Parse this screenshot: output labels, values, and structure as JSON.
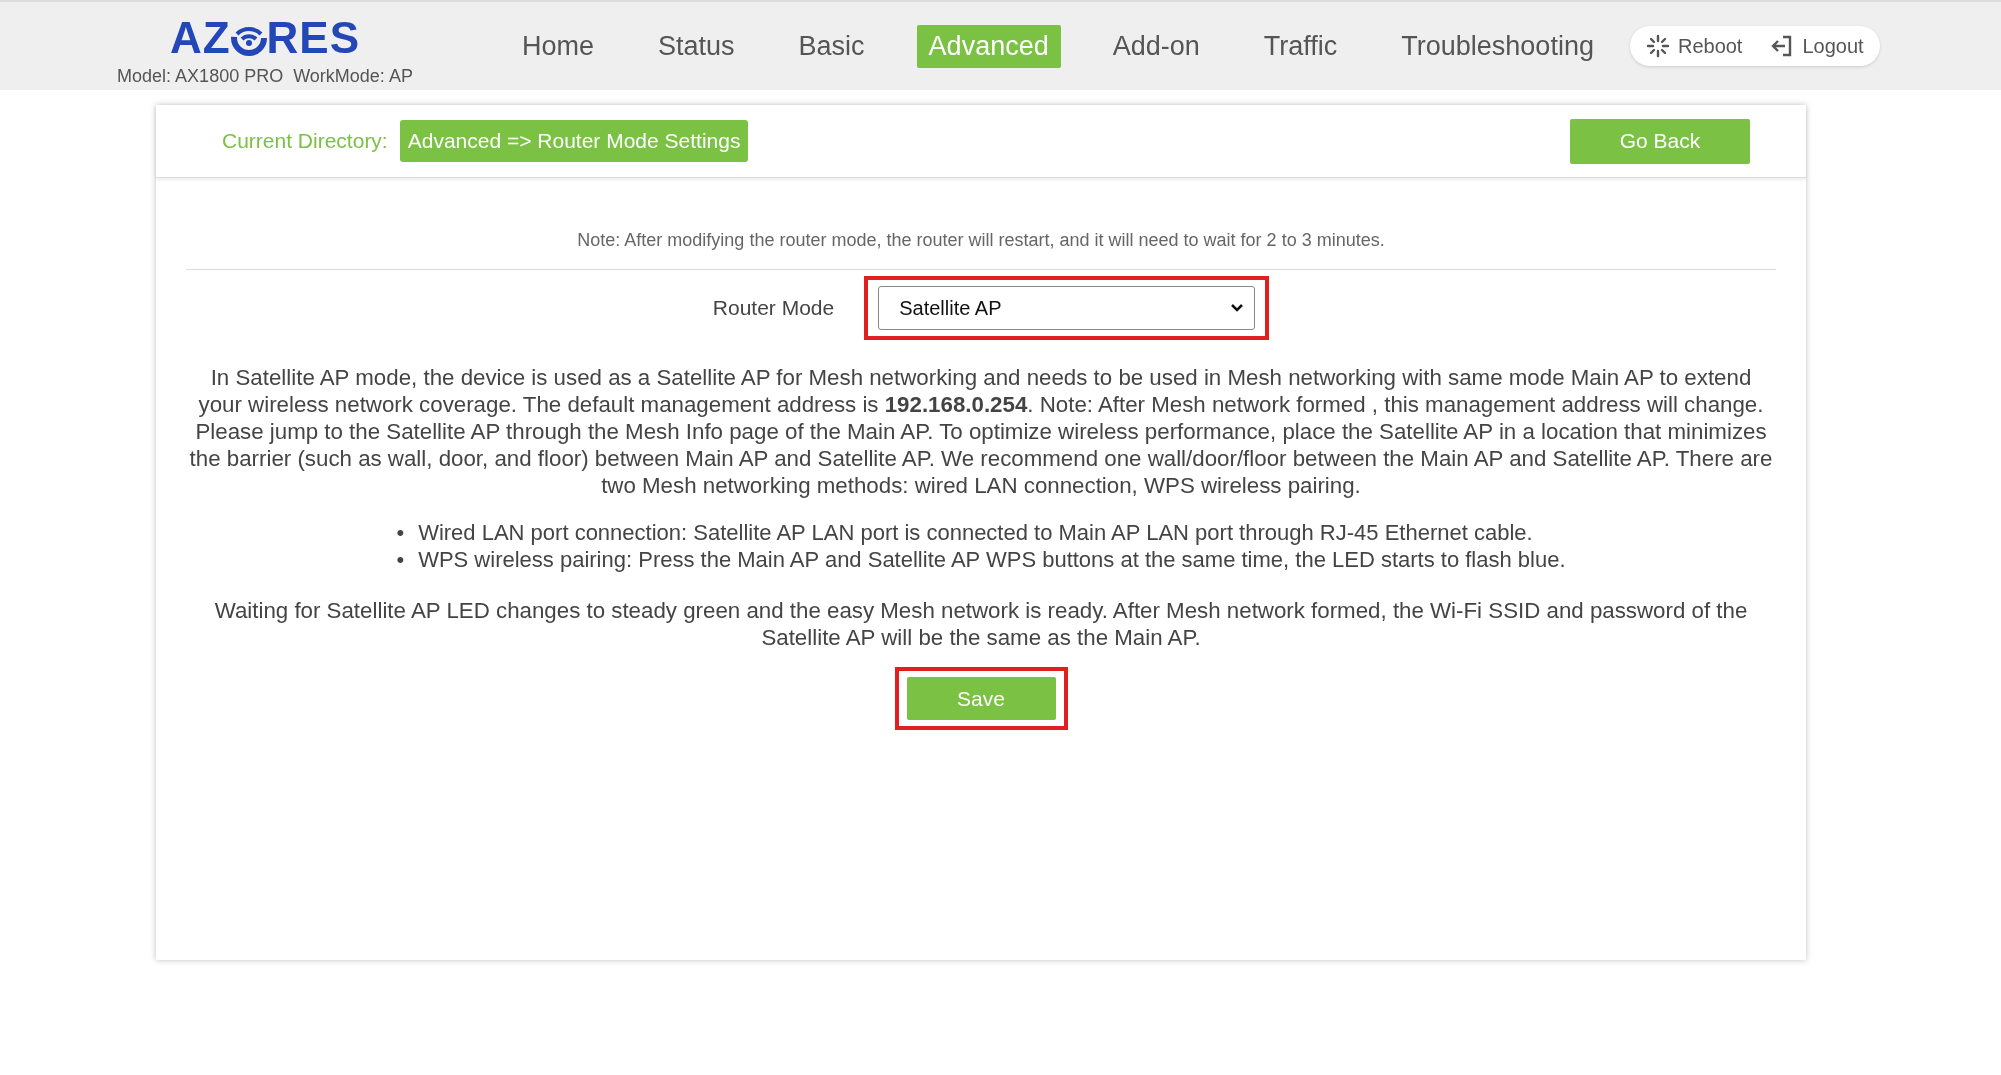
{
  "logo": {
    "before": "AZ",
    "after": "RES"
  },
  "model_info": "Model: AX1800 PRO  WorkMode: AP",
  "nav": [
    {
      "label": "Home",
      "selected": false
    },
    {
      "label": "Status",
      "selected": false
    },
    {
      "label": "Basic",
      "selected": false
    },
    {
      "label": "Advanced",
      "selected": true
    },
    {
      "label": "Add-on",
      "selected": false
    },
    {
      "label": "Traffic",
      "selected": false
    },
    {
      "label": "Troubleshooting",
      "selected": false
    }
  ],
  "actions": [
    {
      "kind": "reboot",
      "label": "Reboot"
    },
    {
      "kind": "logout",
      "label": "Logout"
    }
  ],
  "directory": {
    "label": "Current Directory:",
    "path": "Advanced => Router Mode Settings",
    "back_button": "Go Back"
  },
  "note": "Note: After modifying the router mode, the router will restart, and it will need to wait for 2 to 3 minutes.",
  "router_mode": {
    "label": "Router Mode",
    "value": "Satellite AP",
    "highlighted": true
  },
  "description": "In Satellite AP mode, the device is used as a Satellite AP for Mesh networking and needs to be used in Mesh networking with same mode Main AP to extend your wireless network coverage. The default management address is **192.168.0.254**. Note: After Mesh network formed , this management address will change. Please jump to the Satellite AP through the Mesh Info page of the Main AP. To optimize wireless performance, place the Satellite AP in a location that minimizes the barrier (such as wall, door, and floor) between Main AP and Satellite AP. We recommend one wall/door/floor between the Main AP and Satellite AP. There are two Mesh networking methods: wired LAN connection, WPS wireless pairing.",
  "methods": [
    {
      "bullet": "•",
      "text": "Wired LAN port connection: Satellite AP LAN port is connected to Main AP LAN port through RJ-45 Ethernet cable."
    },
    {
      "bullet": "•",
      "text": "WPS wireless pairing: Press the Main AP and Satellite AP WPS buttons at the same time, the LED starts to flash blue."
    }
  ],
  "footer_text": "Waiting for Satellite AP LED changes to steady green and the easy Mesh network is ready. After Mesh network formed, the Wi-Fi SSID and password of the Satellite AP will be the same as the Main AP.",
  "save_button": {
    "label": "Save",
    "highlighted": true
  }
}
